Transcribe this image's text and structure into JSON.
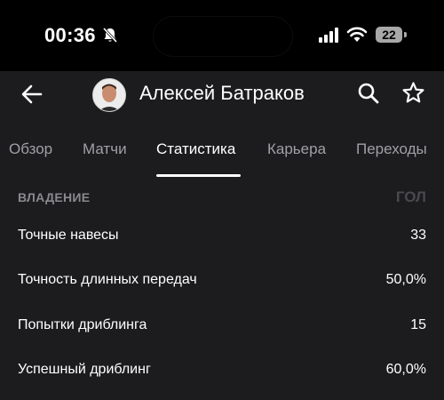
{
  "status_bar": {
    "time": "00:36",
    "battery": "22",
    "icons": [
      "bell-off-icon",
      "signal-icon",
      "wifi-icon",
      "battery-icon"
    ]
  },
  "header": {
    "player_name": "Алексей Батраков",
    "icons": [
      "back-arrow-icon",
      "search-icon",
      "star-icon"
    ]
  },
  "tabs": [
    {
      "label": "Обзор",
      "active": false
    },
    {
      "label": "Матчи",
      "active": false
    },
    {
      "label": "Статистика",
      "active": true
    },
    {
      "label": "Карьера",
      "active": false
    },
    {
      "label": "Переходы",
      "active": false
    }
  ],
  "section": {
    "title": "ВЛАДЕНИЕ",
    "right_text": "ГОЛ"
  },
  "stats": [
    {
      "label": "Точные навесы",
      "value": "33"
    },
    {
      "label": "Точность длинных передач",
      "value": "50,0%"
    },
    {
      "label": "Попытки дриблинга",
      "value": "15"
    },
    {
      "label": "Успешный дриблинг",
      "value": "60,0%"
    }
  ],
  "colors": {
    "background": "#1c1c1e",
    "status_bg": "#000000",
    "text": "#ffffff",
    "muted": "#a0a0a5",
    "section_label": "#8a8a8e"
  }
}
